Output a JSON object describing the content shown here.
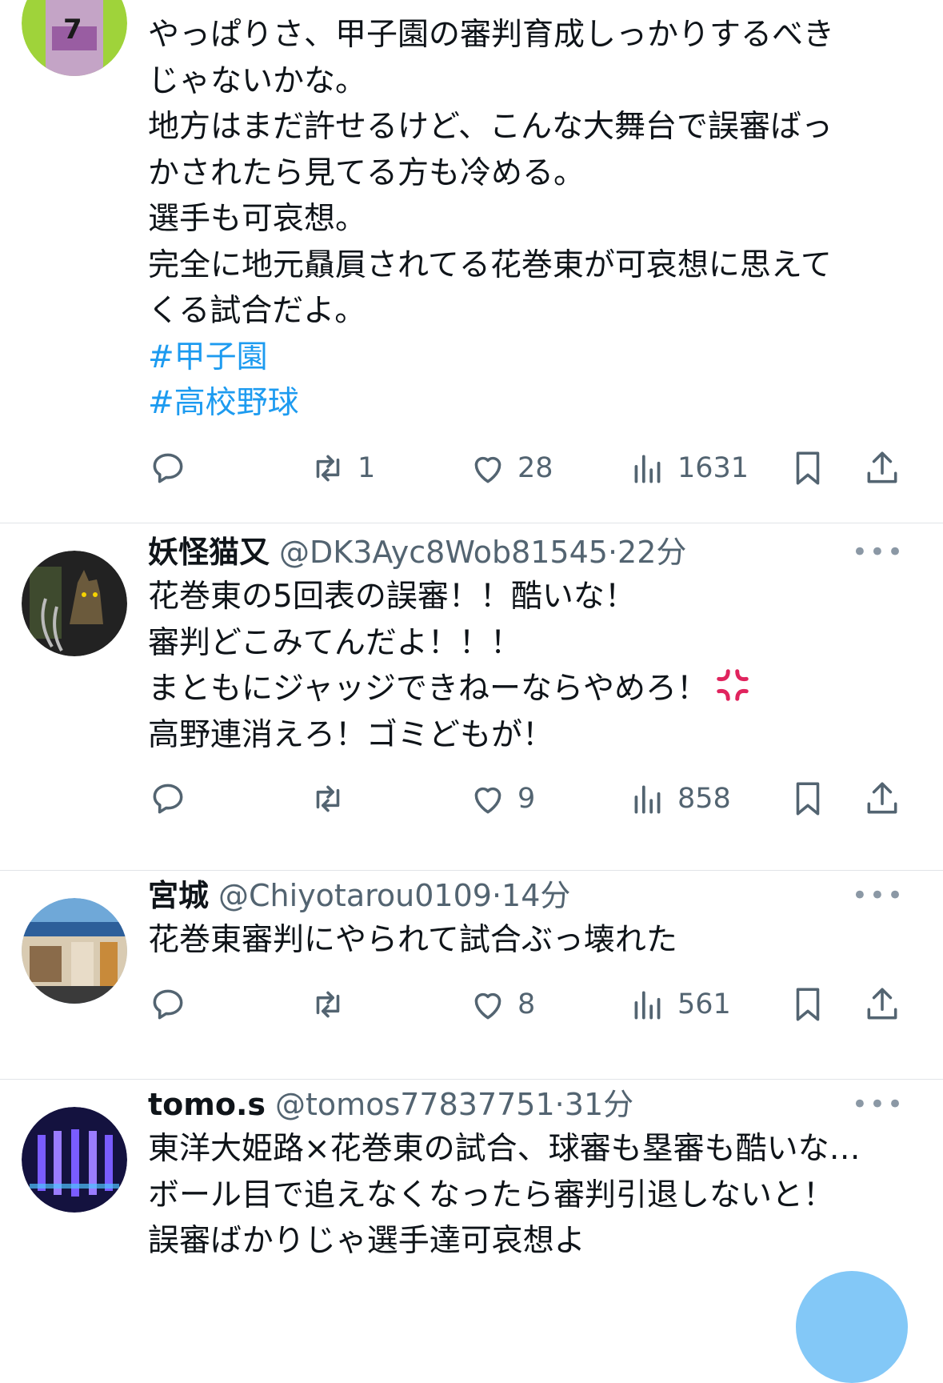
{
  "tweets": [
    {
      "header": {
        "name": "",
        "handle": "",
        "time": ""
      },
      "lines": [
        "やっぱりさ、甲子園の審判育成しっかりするべき",
        "じゃないかな。",
        "地方はまだ許せるけど、こんな大舞台で誤審ばっ",
        "かされたら見てる方も冷める。",
        "選手も可哀想。",
        "完全に地元贔屓されてる花巻東が可哀想に思えて",
        "くる試合だよ。"
      ],
      "hashtags": [
        "#甲子園",
        "#高校野球"
      ],
      "metrics": {
        "retweets": "1",
        "likes": "28",
        "views": "1631"
      },
      "avatar_colors": [
        "#9fd33a",
        "#c4a4c6"
      ]
    },
    {
      "header": {
        "name": "妖怪猫又",
        "handle": "@DK3Ayc8Wob81545",
        "time": "22分"
      },
      "lines": [
        "花巻東の5回表の誤審！！酷いな！",
        "審判どこみてんだよ！！！",
        "まともにジャッジできねーならやめろ！",
        "高野連消えろ！ゴミどもが！"
      ],
      "emoji": {
        "name": "anger-symbol-icon",
        "color": "#e0245e"
      },
      "metrics": {
        "retweets": "",
        "likes": "9",
        "views": "858"
      },
      "avatar_colors": [
        "#2a2a2a",
        "#6a5a3a"
      ]
    },
    {
      "header": {
        "name": "宮城",
        "handle": "@Chiyotarou0109",
        "time": "14分"
      },
      "lines": [
        "花巻東審判にやられて試合ぶっ壊れた"
      ],
      "metrics": {
        "retweets": "",
        "likes": "8",
        "views": "561"
      },
      "avatar_colors": [
        "#4c8fc9",
        "#8a6b4a"
      ]
    },
    {
      "header": {
        "name": "tomo.s",
        "handle": "@tomos77837751",
        "time": "31分"
      },
      "lines": [
        "東洋大姫路×花巻東の試合、球審も塁審も酷いな…",
        "ボール目で追えなくなったら審判引退しないと！",
        "誤審ばかりじゃ選手達可哀想よ"
      ],
      "avatar_colors": [
        "#1a1a5e",
        "#7a5cff"
      ]
    }
  ],
  "ui": {
    "separator": "·",
    "more_glyph": "•••",
    "accent": "#1d9bf0",
    "muted": "#536471"
  }
}
